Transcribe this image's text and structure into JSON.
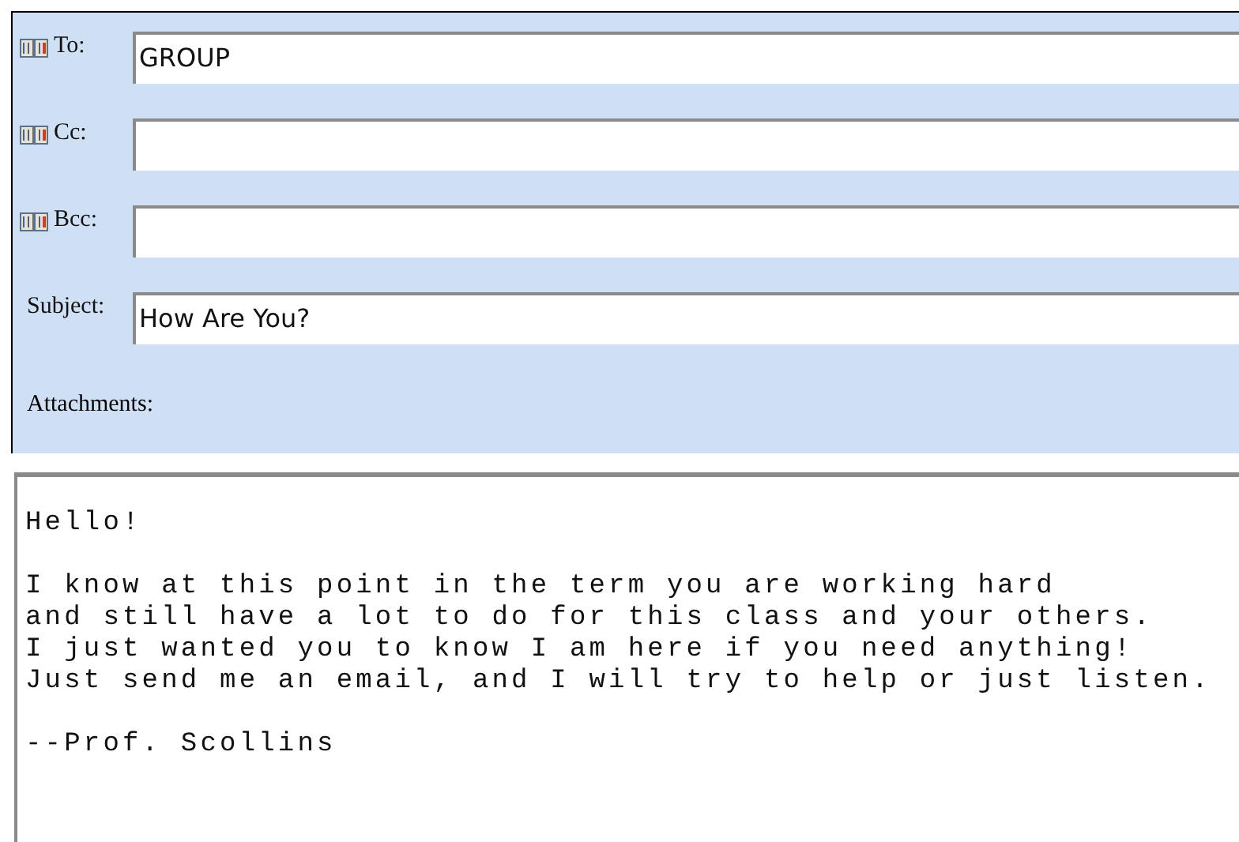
{
  "header_fields": [
    {
      "label": "To:",
      "address_book": true,
      "value": "GROUP"
    },
    {
      "label": "Cc:",
      "address_book": true
    },
    {
      "label": "Bcc:",
      "address_book": true
    },
    {
      "label": "Subject:",
      "address_book": false,
      "value": "How Are You?"
    }
  ],
  "attachments_label": "Attachments:",
  "body": [
    "Hello!",
    "I know at this point in the term you are working hard\nand still have a lot to do for this class and your others.\nI just wanted you to know I am here if you need anything!\nJust send me an email, and I will try to help or just listen.",
    "--Prof. Scollins"
  ]
}
